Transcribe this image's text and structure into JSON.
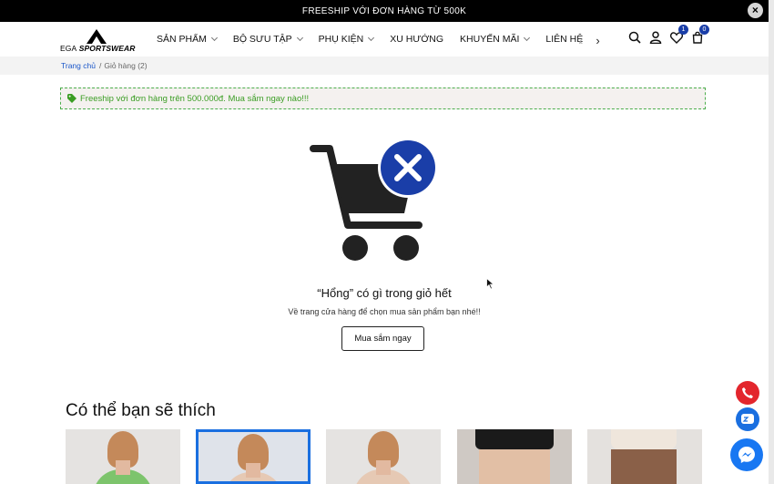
{
  "topbar": {
    "text": "FREESHIP VỚI ĐƠN HÀNG TỪ 500K",
    "close": "×"
  },
  "logo": {
    "text_ega": "EGA",
    "text_brand": "SPORTSWEAR"
  },
  "nav": {
    "items": [
      {
        "label": "SẢN PHẨM",
        "has_dropdown": true
      },
      {
        "label": "BỘ SƯU TẬP",
        "has_dropdown": true
      },
      {
        "label": "PHỤ KIỆN",
        "has_dropdown": true
      },
      {
        "label": "XU HƯỚNG",
        "has_dropdown": false
      },
      {
        "label": "KHUYẾN MÃI",
        "has_dropdown": true
      },
      {
        "label": "LIÊN HỆ",
        "has_dropdown": false
      }
    ],
    "prev": "‹",
    "next": "›"
  },
  "header_icons": {
    "wishlist_count": "1",
    "cart_count": "0"
  },
  "breadcrumb": {
    "home": "Trang chủ",
    "separator": "/",
    "current": "Giỏ hàng (2)"
  },
  "notice": {
    "text": "Freeship với đơn hàng trên 500.000đ. Mua sắm ngay nào!!!"
  },
  "empty_cart": {
    "title": "“Hổng” có gì trong giỏ hết",
    "subtitle": "Về trang cửa hàng để chọn mua sản phẩm bạn nhé!!",
    "button": "Mua sắm ngay"
  },
  "suggestions": {
    "title": "Có thể bạn sẽ thích"
  },
  "colors": {
    "accent": "#1a3ea8",
    "notice_green": "#3a9d23",
    "phone": "#e3262d",
    "zalo": "#1a6fe0",
    "messenger": "#1877f2"
  }
}
